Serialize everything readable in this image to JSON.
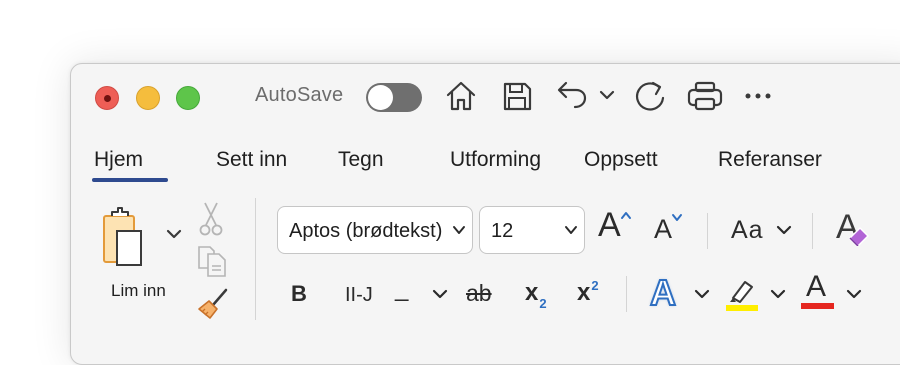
{
  "window": {
    "autosave_label": "AutoSave",
    "autosave_on": false
  },
  "quick_access": [
    "home-icon",
    "save-icon",
    "undo-icon",
    "undo-dropdown-icon",
    "redo-icon",
    "print-icon",
    "more-icon"
  ],
  "tabs": [
    {
      "label": "Hjem",
      "active": true
    },
    {
      "label": "Sett inn"
    },
    {
      "label": "Tegn"
    },
    {
      "label": "Utforming"
    },
    {
      "label": "Oppsett"
    },
    {
      "label": "Referanser"
    }
  ],
  "clipboard": {
    "paste_label": "Lim inn"
  },
  "font": {
    "family": "Aptos (brødtekst)",
    "size": "12",
    "grow_glyph": "A",
    "shrink_glyph": "A",
    "case_label": "Aa",
    "bold": "B",
    "italic_label": "II-J",
    "underline": "_",
    "strike": "ab",
    "subscript_base": "x",
    "subscript_mark": "2",
    "superscript_base": "x",
    "superscript_mark": "2",
    "effects_glyph": "A",
    "font_color_glyph": "A",
    "clear_glyph": "A"
  },
  "colors": {
    "accent_tab": "#2e4a8f",
    "highlight": "#ffee00",
    "font_color": "#e5261f",
    "text_effect": "#2f6fc1"
  }
}
